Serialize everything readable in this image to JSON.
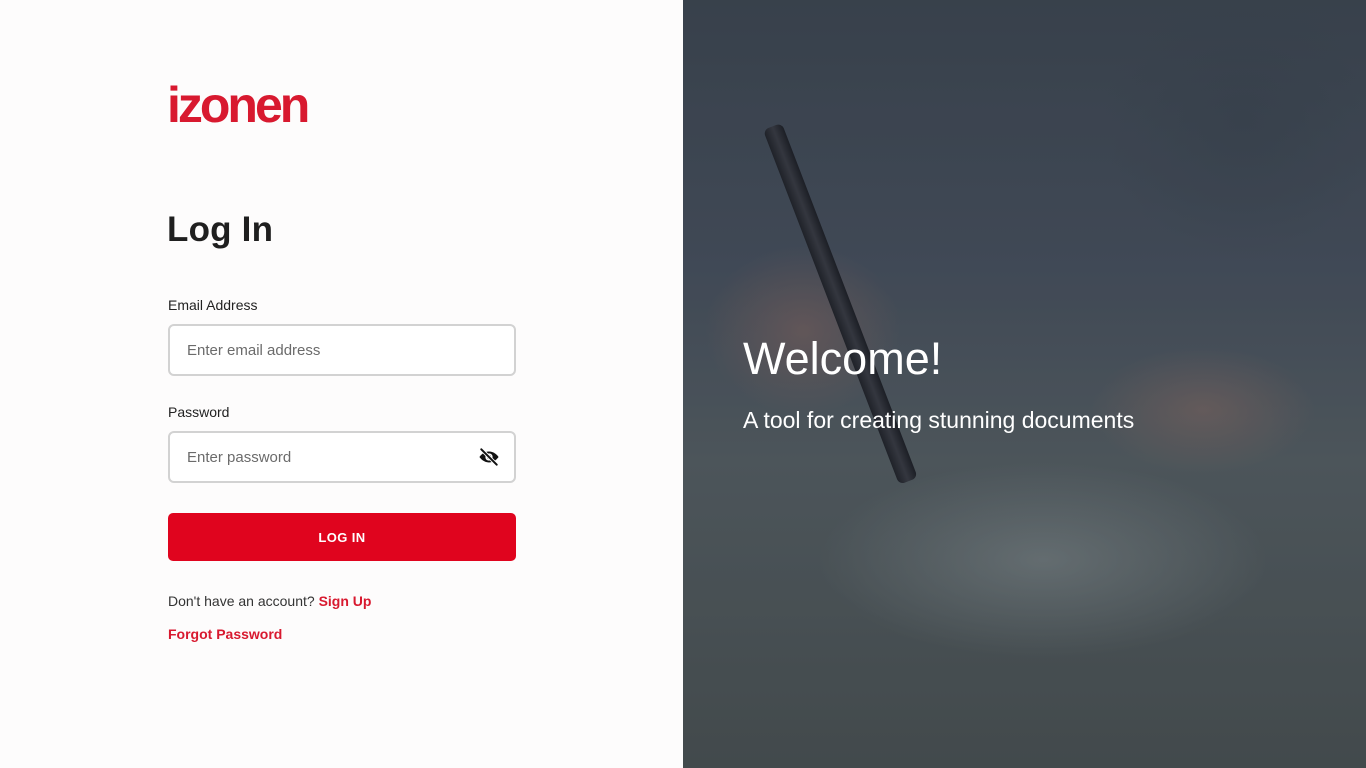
{
  "brand": {
    "logo_text": "izonen",
    "color": "#d8192f"
  },
  "login": {
    "title": "Log In",
    "email": {
      "label": "Email Address",
      "placeholder": "Enter email address"
    },
    "password": {
      "label": "Password",
      "placeholder": "Enter password",
      "toggle_icon": "eye-off-icon"
    },
    "submit_label": "LOG IN",
    "signup_prompt": "Don't have an account?",
    "signup_link": "Sign Up",
    "forgot_link": "Forgot Password"
  },
  "hero": {
    "heading": "Welcome!",
    "subheading": "A tool for creating stunning documents"
  },
  "colors": {
    "accent": "#e0041e"
  }
}
